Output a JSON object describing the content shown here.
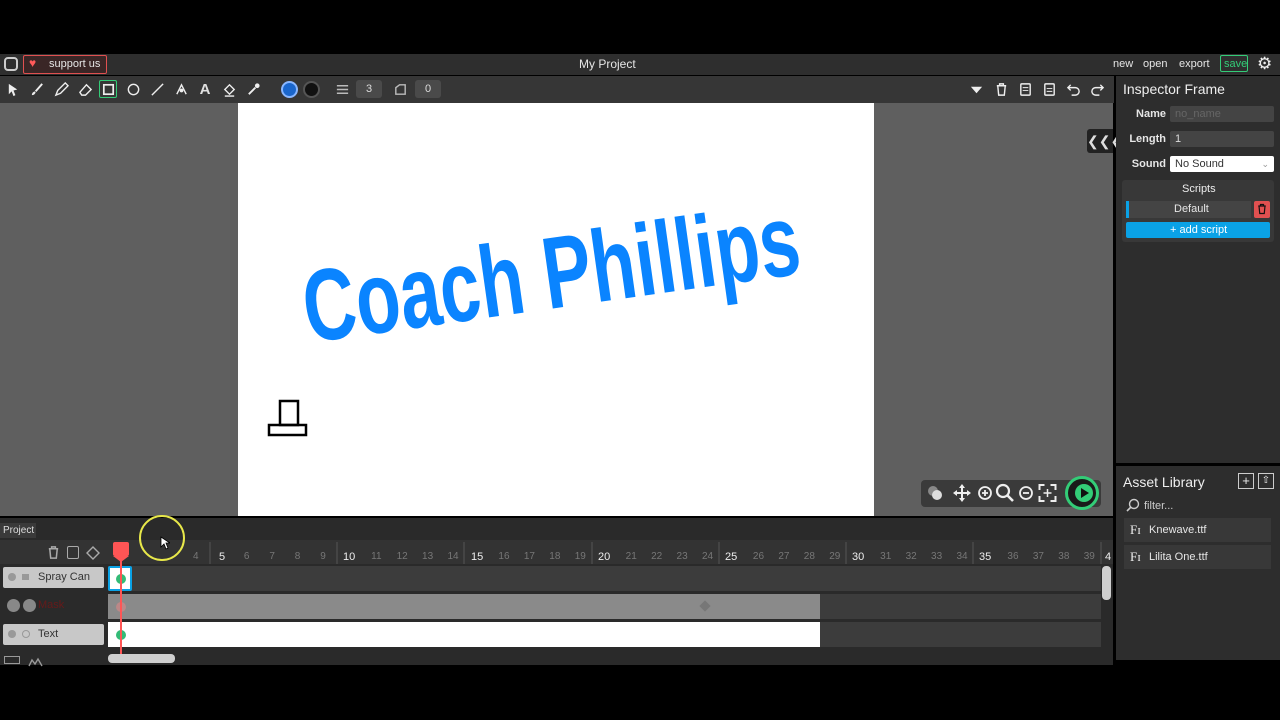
{
  "topbar": {
    "support_label": "support us",
    "project_title": "My Project",
    "menu": [
      "new",
      "open",
      "export"
    ],
    "save_label": "save"
  },
  "toolbar": {
    "brush_size": "3",
    "rotation_value": "0"
  },
  "stage": {
    "canvas_text": "Coach Phillips",
    "text_color": "#0a84ff"
  },
  "inspector": {
    "title": "Inspector",
    "subtitle": "Frame",
    "name_label": "Name",
    "name_placeholder": "no_name",
    "length_label": "Length",
    "length_value": "1",
    "sound_label": "Sound",
    "sound_value": "No Sound",
    "scripts_label": "Scripts",
    "script_default": "Default",
    "add_script_label": "+ add script"
  },
  "assets": {
    "title": "Asset Library",
    "filter_placeholder": "filter...",
    "items": [
      "Knewave.ttf",
      "Lilita One.ttf"
    ]
  },
  "timeline": {
    "tab_label": "Project",
    "layers": [
      "Spray Can",
      "Mask",
      "Text"
    ],
    "ruler_major": [
      "5",
      "10",
      "15",
      "20",
      "25",
      "30",
      "35",
      "4"
    ],
    "ruler_minor": [
      "4",
      "6",
      "7",
      "8",
      "9",
      "11",
      "12",
      "13",
      "14",
      "16",
      "17",
      "18",
      "19",
      "21",
      "22",
      "23",
      "24",
      "26",
      "27",
      "28",
      "29",
      "31",
      "32",
      "33",
      "34",
      "36",
      "37",
      "38",
      "39"
    ]
  },
  "colors": {
    "accent_green": "#33cc77",
    "playhead_red": "#ff5555",
    "script_blue": "#0aa2e6"
  }
}
